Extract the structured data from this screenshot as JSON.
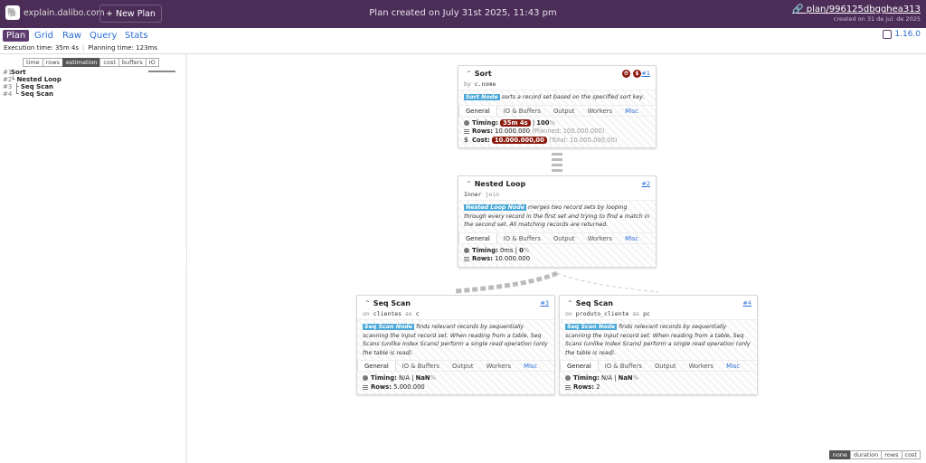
{
  "header": {
    "brand": "explain.dalibo.com",
    "new_plan": "+ New Plan",
    "title": "Plan created on July 31st 2025, 11:43 pm",
    "plan_link": "plan/996125dbgghea313",
    "created": "created on 31 de jul. de 2025"
  },
  "nav": {
    "tabs": [
      "Plan",
      "Grid",
      "Raw",
      "Query",
      "Stats"
    ],
    "version": "1.16.0"
  },
  "info": {
    "exec": "Execution time: 35m 4s",
    "planning": "Planning time: 123ms"
  },
  "left": {
    "buttons": [
      "time",
      "rows",
      "estimation",
      "cost",
      "buffers",
      "IO"
    ],
    "active": "estimation",
    "tree": [
      {
        "num": "#1",
        "name": "Sort",
        "prefix": ""
      },
      {
        "num": "#2",
        "name": "Nested Loop",
        "prefix": "└ "
      },
      {
        "num": "#3",
        "name": "Seq Scan",
        "prefix": "  ├ "
      },
      {
        "num": "#4",
        "name": "Seq Scan",
        "prefix": "  └ "
      }
    ]
  },
  "view": {
    "buttons": [
      "none",
      "duration",
      "rows",
      "cost"
    ],
    "active": "none"
  },
  "tab_labels": {
    "general": "General",
    "io": "IO & Buffers",
    "output": "Output",
    "workers": "Workers",
    "misc": "Misc"
  },
  "nodes": {
    "sort": {
      "name": "Sort",
      "id": "#1",
      "sub_kw": "by",
      "sub_val": "c.nome",
      "badge": "Sort Node",
      "desc": "sorts a record set based on the specified sort key.",
      "timing": "35m 4s",
      "timing_pct": "100",
      "rows": "10.000.000",
      "rows_planned": "(Planned: 100.000.000)",
      "cost": "10.000.000,00",
      "cost_total": "(Total: 10.000.000,00)"
    },
    "nested": {
      "name": "Nested Loop",
      "id": "#2",
      "sub_kw1": "Inner",
      "sub_kw2": "join",
      "badge": "Nested Loop Node",
      "desc": "merges two record sets by looping through every record in the first set and trying to find a match in the second set. All matching records are returned.",
      "timing": "0ms",
      "timing_pct": "0",
      "rows": "10.000.000"
    },
    "scan1": {
      "name": "Seq Scan",
      "id": "#3",
      "sub_kw": "on",
      "sub_val": "clientes",
      "sub_as": "as",
      "sub_alias": "c",
      "badge": "Seq Scan Node",
      "desc": "finds relevant records by sequentially scanning the input record set. When reading from a table, Seq Scans (unlike Index Scans) perform a single read operation (only the table is read).",
      "timing": "N/A",
      "timing_pct": "NaN",
      "rows": "5.000.000"
    },
    "scan2": {
      "name": "Seq Scan",
      "id": "#4",
      "sub_kw": "on",
      "sub_val": "produto_cliente",
      "sub_as": "as",
      "sub_alias": "pc",
      "badge": "Seq Scan Node",
      "desc": "finds relevant records by sequentially scanning the input record set. When reading from a table, Seq Scans (unlike Index Scans) perform a single read operation (only the table is read).",
      "timing": "N/A",
      "timing_pct": "NaN",
      "rows": "2"
    }
  },
  "stat_labels": {
    "timing": "Timing:",
    "rows": "Rows:",
    "cost": "Cost:",
    "pct": "%"
  },
  "colors": {
    "header": "#4b2d57",
    "accent": "#5e3b6e",
    "link": "#2a6fd6",
    "badge": "#4aa8d8",
    "danger": "#8b1a0e"
  }
}
